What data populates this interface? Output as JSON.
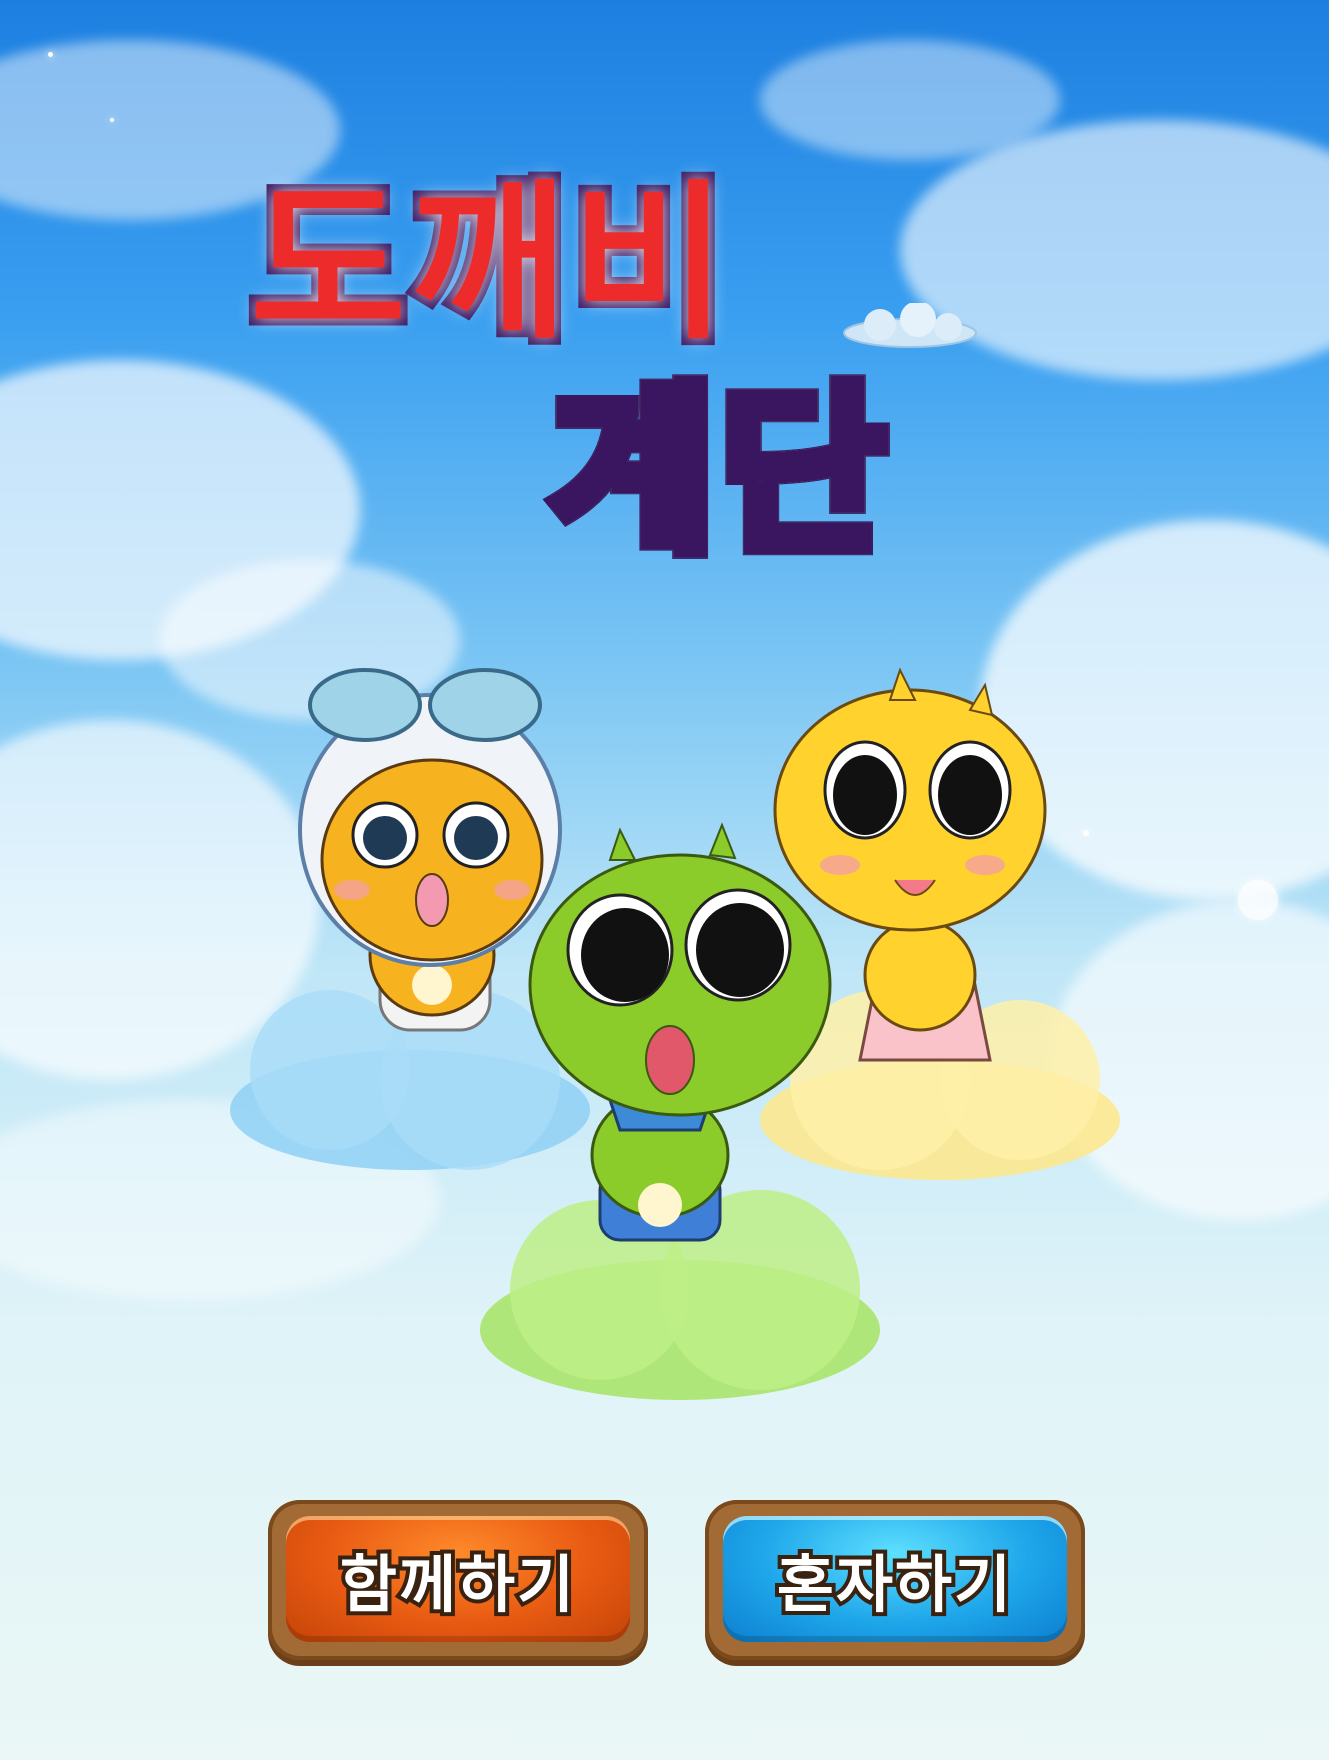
{
  "title": {
    "line1": "도깨비",
    "line2": "계단"
  },
  "buttons": {
    "together_label": "함께하기",
    "solo_label": "혼자하기"
  },
  "characters": [
    {
      "name": "pilot-goblin-character",
      "color": "#f7b21f",
      "cloud_color": "#8fd0f5"
    },
    {
      "name": "green-goblin-character",
      "color": "#8ccc2a",
      "cloud_color": "#a8e46a"
    },
    {
      "name": "yellow-goblin-character",
      "color": "#ffd22e",
      "cloud_color": "#ffe88a"
    }
  ],
  "colors": {
    "title_red": "#ee2b2b",
    "title_outline": "#3b1660",
    "button_orange": "#e85a12",
    "button_blue": "#1ea6ea"
  }
}
